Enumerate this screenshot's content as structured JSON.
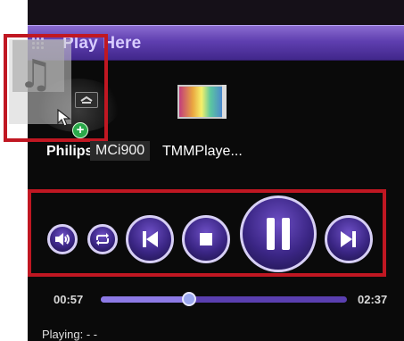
{
  "header": {
    "title": "Play Here"
  },
  "devices": [
    {
      "name_a": "Philips",
      "name_b": "MCi900"
    },
    {
      "name": "TMMPlaye..."
    }
  ],
  "player": {
    "time_current": "00:57",
    "time_total": "02:37",
    "progress": 0.36,
    "status": "Playing:  - -"
  },
  "colors": {
    "highlight_red": "#c01722",
    "header_purple": "#5f3fb0",
    "button_purple": "#3b2685"
  },
  "icons": {
    "drag": "music-note-icon",
    "cursor": "arrow-cursor-icon",
    "add": "plus-icon",
    "volume": "speaker-icon",
    "repeat": "repeat-icon",
    "previous": "previous-icon",
    "stop": "stop-icon",
    "pause": "pause-icon",
    "next": "next-icon"
  }
}
